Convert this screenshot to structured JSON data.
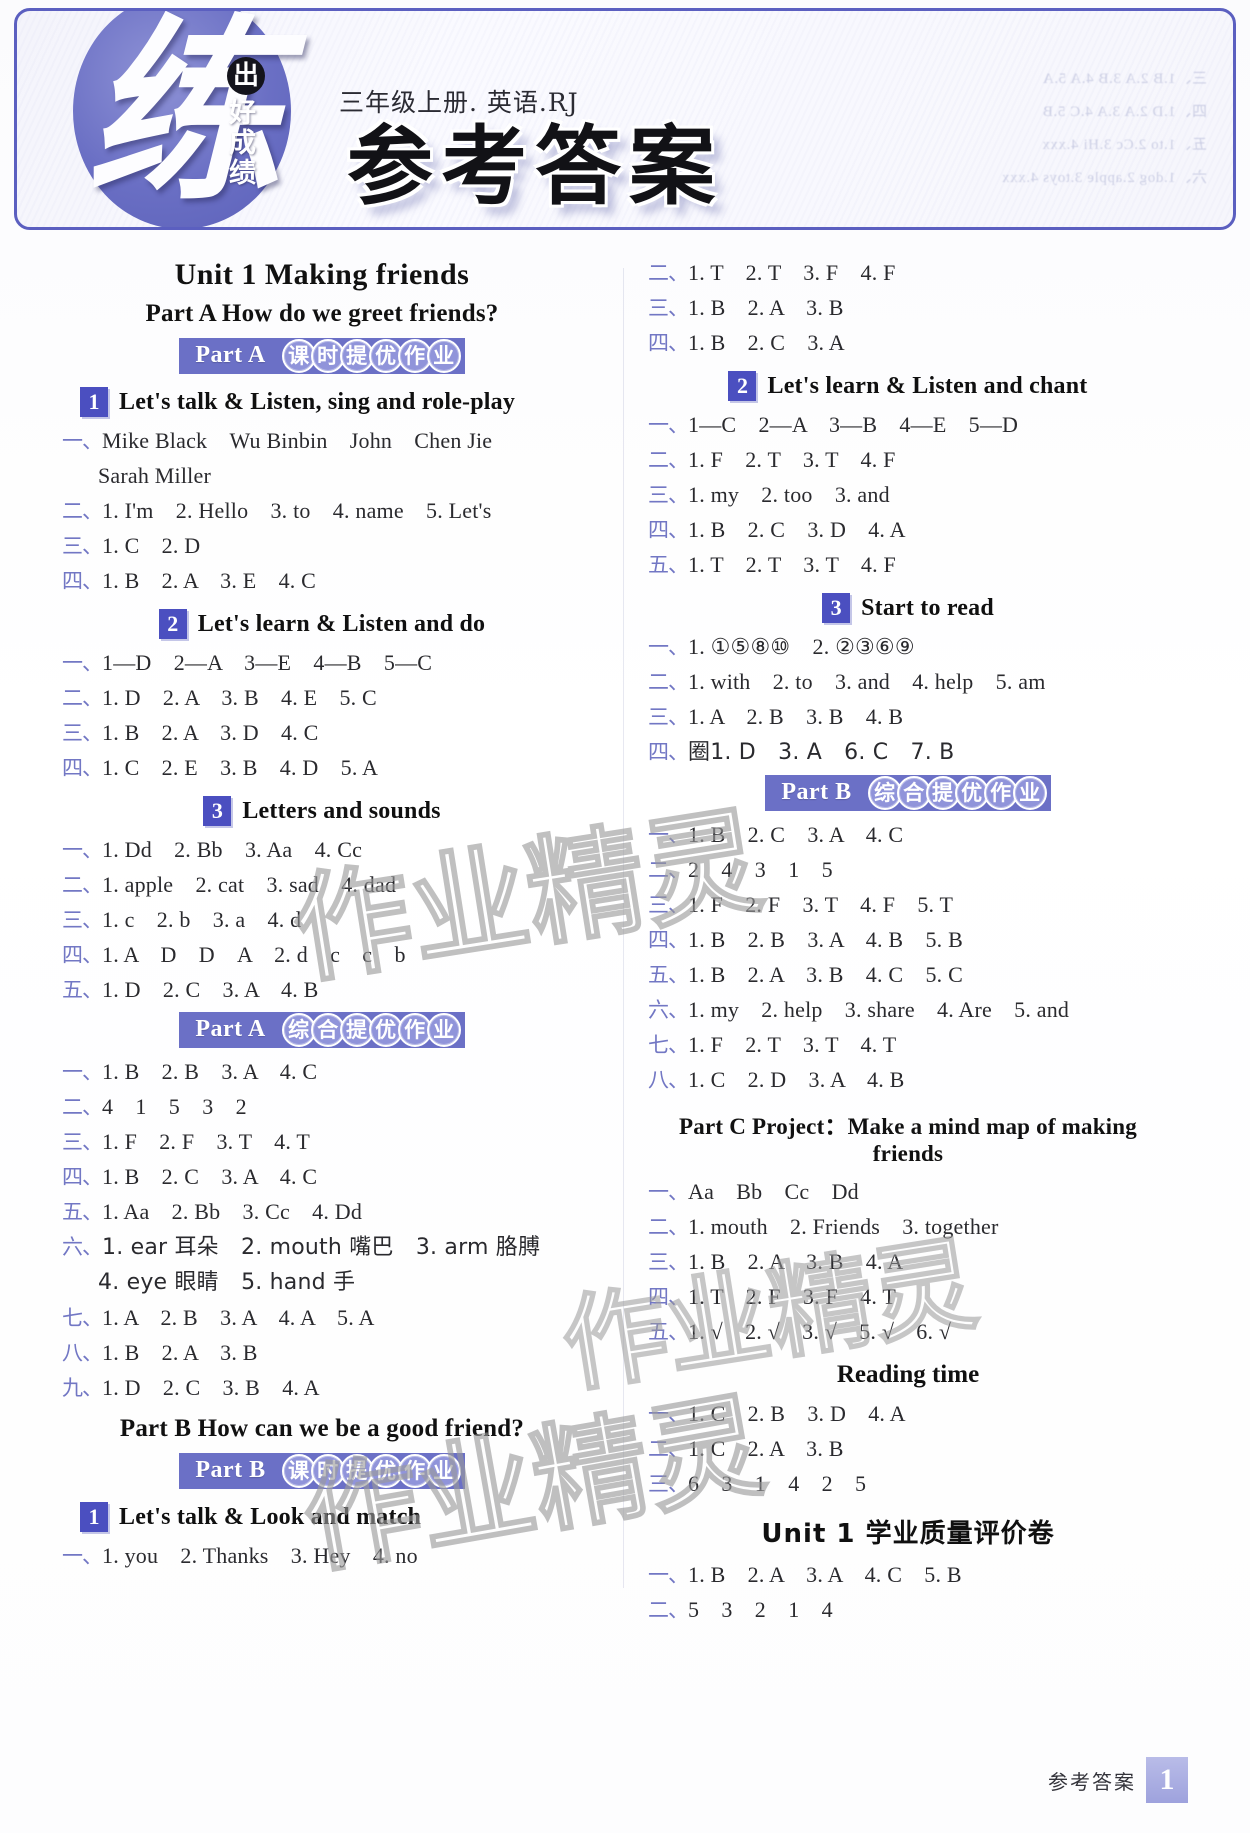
{
  "header": {
    "brand_logo_char": "练",
    "brand_badge_char": "出",
    "brand_sub_chars": "好成绩",
    "subject_line": "三年级上册. 英语.RJ",
    "main_title": "参考答案",
    "ghost_lines": [
      "三、1.B 2.A 3.B 4.A 5.A",
      "四、1.D 2.A 3.A 4.C 5.B",
      "五、1.to 2.Cc 3.Hi 4.xxx",
      "六、1.dog 2.apple 3.toys 4.xxx"
    ]
  },
  "watermarks": [
    "作业精灵",
    "作业精灵",
    "作业精灵"
  ],
  "footer": {
    "label": "参考答案",
    "page_number": "1"
  },
  "left_column": {
    "unit_title": "Unit 1    Making friends",
    "part_a_line": "Part A     How do we greet friends?",
    "banner_a_kt": {
      "tab": "Part A",
      "bubbles": [
        "课",
        "时",
        "提",
        "优",
        "作",
        "业"
      ]
    },
    "sec1": {
      "num": "1",
      "label": "Let's talk & Listen, sing and role-play"
    },
    "sec1_rows": [
      {
        "cn": "一、",
        "body": "Mike Black　Wu Binbin　John　Chen Jie"
      },
      {
        "cn": "",
        "body": "Sarah Miller",
        "cont": true
      },
      {
        "cn": "二、",
        "body": "1. I'm　2. Hello　3. to　4. name　5. Let's"
      },
      {
        "cn": "三、",
        "body": "1. C　2. D"
      },
      {
        "cn": "四、",
        "body": "1. B　2. A　3. E　4. C"
      }
    ],
    "sec2": {
      "num": "2",
      "label": "Let's learn & Listen and do"
    },
    "sec2_rows": [
      {
        "cn": "一、",
        "body": "1—D　2—A　3—E　4—B　5—C"
      },
      {
        "cn": "二、",
        "body": "1. D　2. A　3. B　4. E　5. C"
      },
      {
        "cn": "三、",
        "body": "1. B　2. A　3. D　4. C"
      },
      {
        "cn": "四、",
        "body": "1. C　2. E　3. B　4. D　5. A"
      }
    ],
    "sec3": {
      "num": "3",
      "label": "Letters and sounds"
    },
    "sec3_rows": [
      {
        "cn": "一、",
        "body": "1. Dd　2. Bb　3. Aa　4. Cc"
      },
      {
        "cn": "二、",
        "body": "1. apple　2. cat　3. sad　4. dad"
      },
      {
        "cn": "三、",
        "body": "1. c　2. b　3. a　4. d"
      },
      {
        "cn": "四、",
        "body": "1. A　D　D　A　2. d　c　c　b"
      },
      {
        "cn": "五、",
        "body": "1. D　2. C　3. A　4. B"
      }
    ],
    "banner_a_zh": {
      "tab": "Part A",
      "bubbles": [
        "综",
        "合",
        "提",
        "优",
        "作",
        "业"
      ]
    },
    "zh_rows": [
      {
        "cn": "一、",
        "body": "1. B　2. B　3. A　4. C"
      },
      {
        "cn": "二、",
        "body": "4　1　5　3　2"
      },
      {
        "cn": "三、",
        "body": "1. F　2. F　3. T　4. T"
      },
      {
        "cn": "四、",
        "body": "1. B　2. C　3. A　4. C"
      },
      {
        "cn": "五、",
        "body": "1. Aa　2. Bb　3. Cc　4. Dd"
      },
      {
        "cn": "六、",
        "body": "1. ear 耳朵　2. mouth 嘴巴　3. arm 胳膊"
      },
      {
        "cn": "",
        "body": "4. eye 眼睛　5. hand 手",
        "cont": true
      },
      {
        "cn": "七、",
        "body": "1. A　2. B　3. A　4. A　5. A"
      },
      {
        "cn": "八、",
        "body": "1. B　2. A　3. B"
      },
      {
        "cn": "九、",
        "body": "1. D　2. C　3. B　4. A"
      }
    ],
    "part_b_line": "Part B    How can we be a good friend?",
    "banner_b_kt": {
      "tab": "Part B",
      "bubbles": [
        "课",
        "时",
        "提",
        "优",
        "作",
        "业"
      ]
    },
    "secb1": {
      "num": "1",
      "label": "Let's talk & Look and match"
    },
    "secb1_rows": [
      {
        "cn": "一、",
        "body": "1. you　2. Thanks　3. Hey　4. no"
      }
    ]
  },
  "right_column": {
    "top_rows": [
      {
        "cn": "二、",
        "body": "1. T　2. T　3. F　4. F"
      },
      {
        "cn": "三、",
        "body": "1. B　2. A　3. B"
      },
      {
        "cn": "四、",
        "body": "1. B　2. C　3. A"
      }
    ],
    "sec2": {
      "num": "2",
      "label": "Let's learn & Listen and chant"
    },
    "sec2_rows": [
      {
        "cn": "一、",
        "body": "1—C　2—A　3—B　4—E　5—D"
      },
      {
        "cn": "二、",
        "body": "1. F　2. T　3. T　4. F"
      },
      {
        "cn": "三、",
        "body": "1. my　2. too　3. and"
      },
      {
        "cn": "四、",
        "body": "1. B　2. C　3. D　4. A"
      },
      {
        "cn": "五、",
        "body": "1. T　2. T　3. T　4. F"
      }
    ],
    "sec3": {
      "num": "3",
      "label": "Start to read"
    },
    "sec3_rows": [
      {
        "cn": "一、",
        "body": "1. ①⑤⑧⑩　2. ②③⑥⑨"
      },
      {
        "cn": "二、",
        "body": "1. with　2. to　3. and　4. help　5. am"
      },
      {
        "cn": "三、",
        "body": "1. A　2. B　3. B　4. B"
      },
      {
        "cn": "四、",
        "body": "圈1. D　3. A　6. C　7. B"
      }
    ],
    "banner_b_zh": {
      "tab": "Part B",
      "bubbles": [
        "综",
        "合",
        "提",
        "优",
        "作",
        "业"
      ]
    },
    "zh_rows": [
      {
        "cn": "一、",
        "body": "1. B　2. C　3. A　4. C"
      },
      {
        "cn": "二、",
        "body": "2　4　3　1　5"
      },
      {
        "cn": "三、",
        "body": "1. F　2. F　3. T　4. F　5. T"
      },
      {
        "cn": "四、",
        "body": "1. B　2. B　3. A　4. B　5. B"
      },
      {
        "cn": "五、",
        "body": "1. B　2. A　3. B　4. C　5. C"
      },
      {
        "cn": "六、",
        "body": "1. my　2. help　3. share　4. Are　5. and"
      },
      {
        "cn": "七、",
        "body": "1. F　2. T　3. T　4. T"
      },
      {
        "cn": "八、",
        "body": "1. C　2. D　3. A　4. B"
      }
    ],
    "part_c_line": "Part C    Project：Make a mind map of making friends",
    "partc_rows": [
      {
        "cn": "一、",
        "body": "Aa　Bb　Cc　Dd"
      },
      {
        "cn": "二、",
        "body": "1. mouth　2. Friends　3. together"
      },
      {
        "cn": "三、",
        "body": "1. B　2. A　3. B　4. A"
      },
      {
        "cn": "四、",
        "body": "1. T　2. F　3. F　4. T"
      },
      {
        "cn": "五、",
        "body": "1. √　2. √　3. √　5. √　6. √"
      }
    ],
    "reading_head": "Reading time",
    "reading_rows": [
      {
        "cn": "一、",
        "body": "1. C　2. B　3. D　4. A"
      },
      {
        "cn": "二、",
        "body": "1. C　2. A　3. B"
      },
      {
        "cn": "三、",
        "body": "6　3　1　4　2　5"
      }
    ],
    "unit_eval_head": "Unit 1 学业质量评价卷",
    "eval_rows": [
      {
        "cn": "一、",
        "body": "1. B　2. A　3. A　4. C　5. B"
      },
      {
        "cn": "二、",
        "body": "5　3　2　1　4"
      }
    ]
  }
}
